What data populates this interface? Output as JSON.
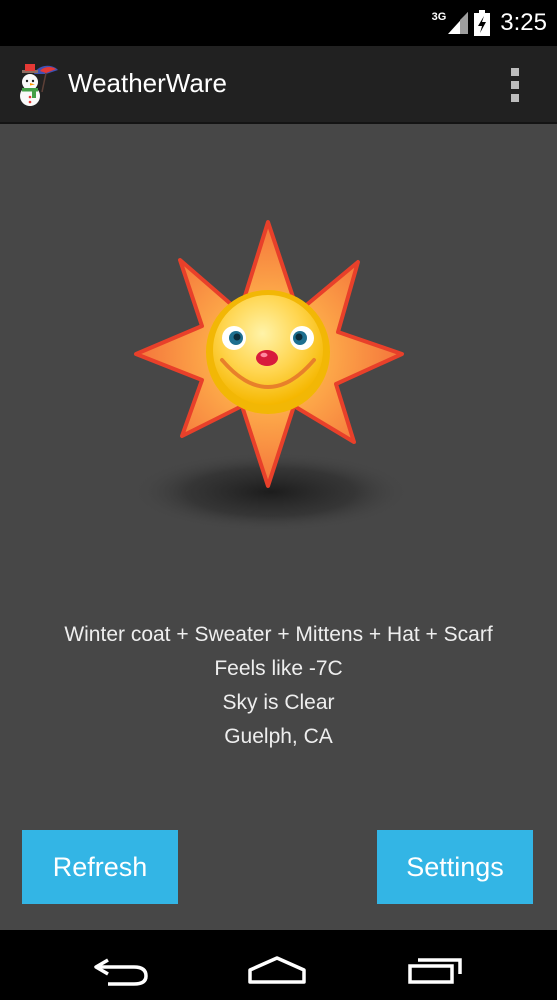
{
  "status_bar": {
    "network": "3G",
    "time": "3:25",
    "icons": [
      "signal-icon",
      "battery-charging-icon"
    ]
  },
  "app_bar": {
    "title": "WeatherWare",
    "icon": "snowman-umbrella-icon",
    "overflow_icon": "overflow-menu-icon"
  },
  "weather": {
    "icon": "smiling-sun-icon",
    "clothing": "Winter coat + Sweater + Mittens + Hat + Scarf",
    "feels_like": "Feels like -7C",
    "sky": "Sky is Clear",
    "location": "Guelph, CA"
  },
  "buttons": {
    "refresh": "Refresh",
    "settings": "Settings"
  },
  "nav_bar": {
    "icons": [
      "back-icon",
      "home-icon",
      "recents-icon"
    ]
  },
  "colors": {
    "accent": "#33b5e5",
    "action_bar": "#212121",
    "content_background": "#474747",
    "text": "#eeeeee"
  }
}
